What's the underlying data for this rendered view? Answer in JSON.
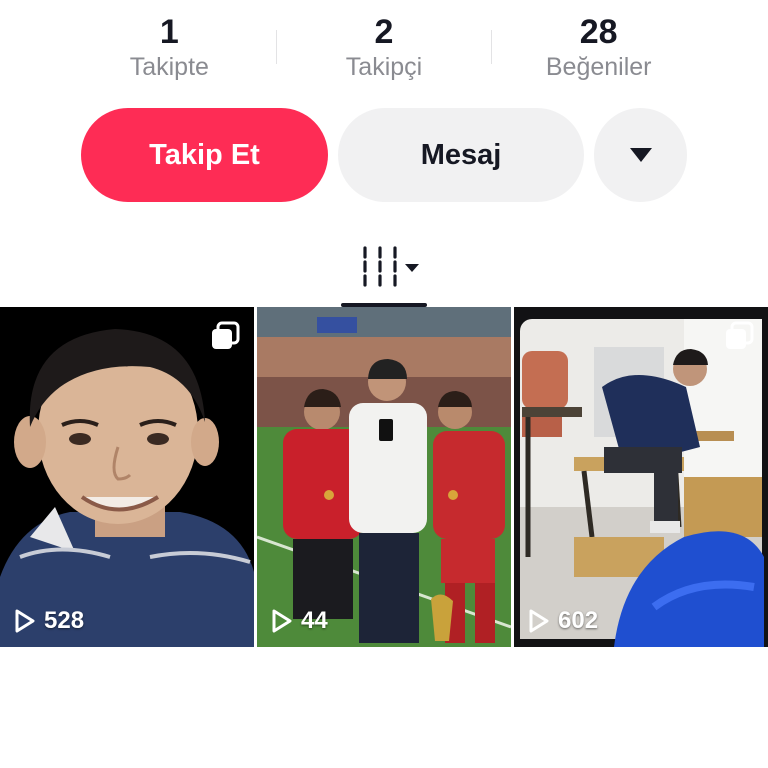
{
  "stats": [
    {
      "value": "1",
      "label": "Takipte"
    },
    {
      "value": "2",
      "label": "Takipçi"
    },
    {
      "value": "28",
      "label": "Beğeniler"
    }
  ],
  "actions": {
    "follow_label": "Takip Et",
    "message_label": "Mesaj",
    "more_icon": "caret-down-icon"
  },
  "tabs": {
    "active_icon": "grid-filter-icon"
  },
  "videos": [
    {
      "views": "528",
      "multi_icon": "carousel-icon"
    },
    {
      "views": "44"
    },
    {
      "views": "602",
      "multi_icon": "carousel-icon"
    }
  ],
  "colors": {
    "accent": "#fe2c55",
    "secondary_button": "#f1f1f2",
    "text": "#161823",
    "muted": "#8a8b91"
  }
}
